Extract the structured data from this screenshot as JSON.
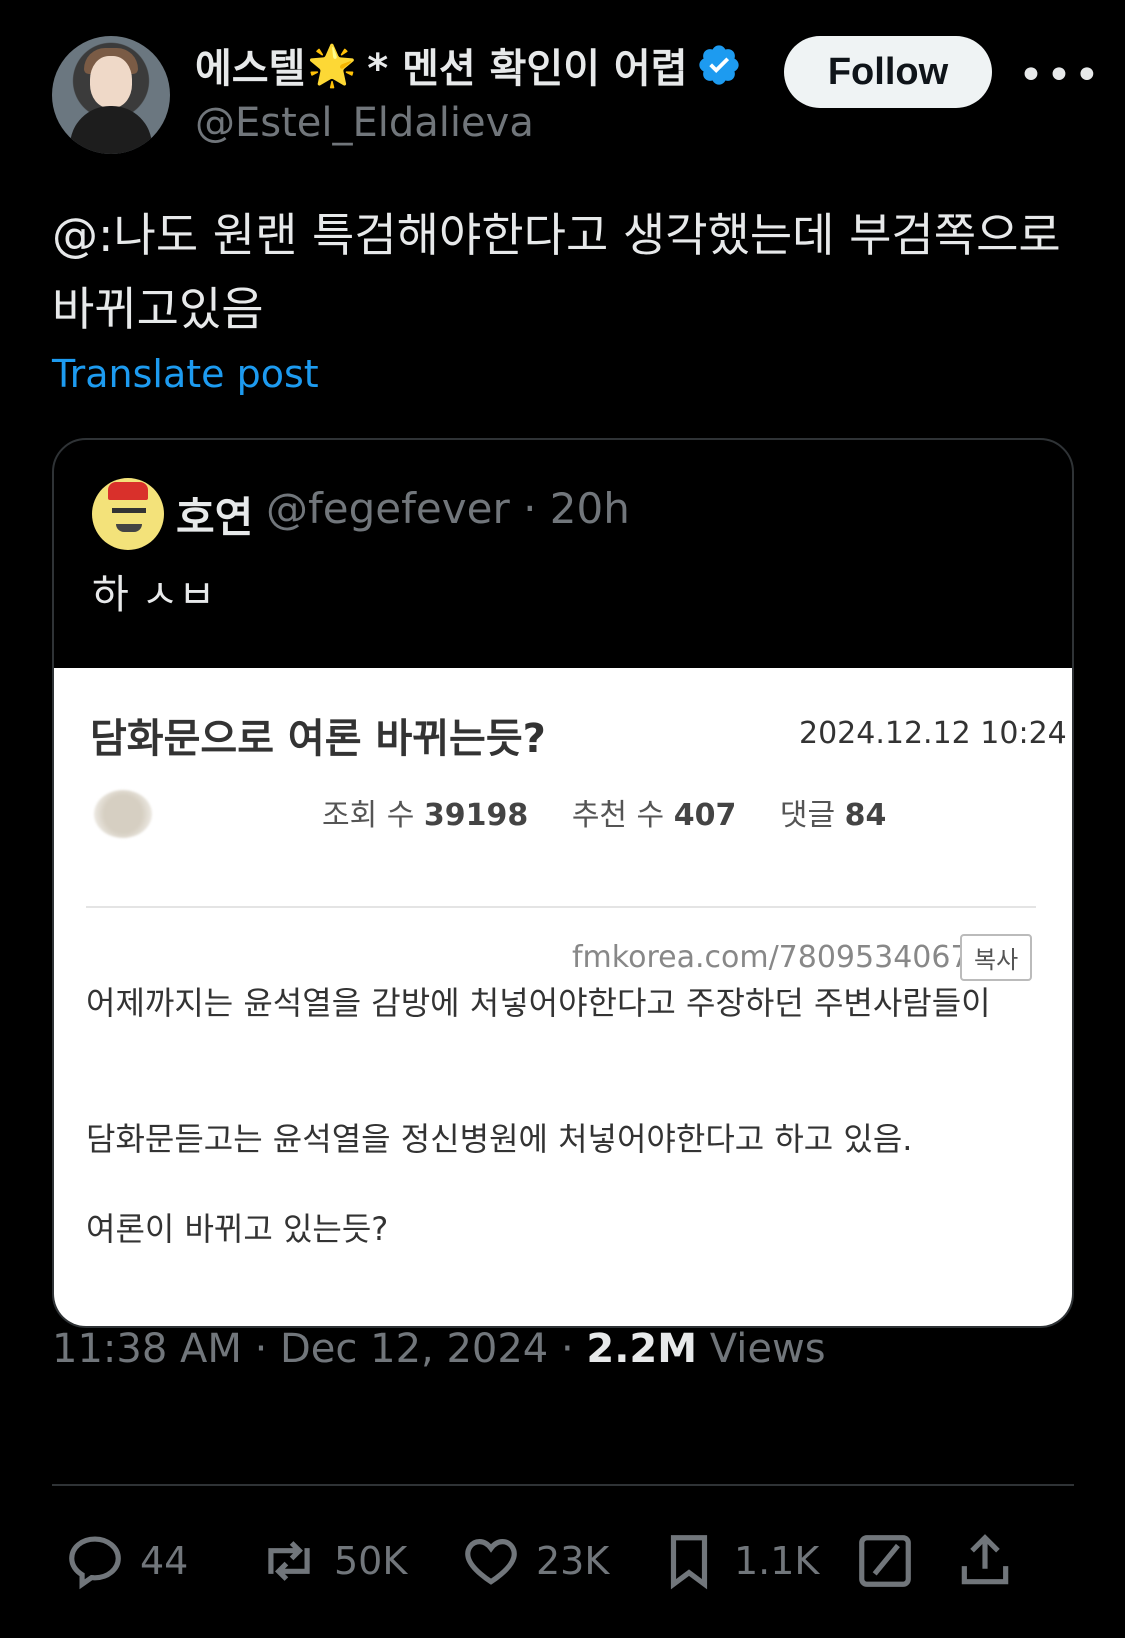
{
  "author": {
    "name": "에스텔",
    "emoji": "🌟",
    "name_suffix": "* 멘션 확인이 어렵",
    "handle": "@Estel_Eldalieva",
    "follow_label": "Follow",
    "more_label": "•••"
  },
  "post": {
    "text": "@:나도 원랜 특검해야한다고 생각했는데 부검쪽으로 바뀌고있음",
    "translate_label": "Translate post"
  },
  "quote": {
    "name": "호연",
    "meta": "@fegefever · 20h",
    "text": "하 ㅅㅂ",
    "screenshot": {
      "title": "담화문으로 여론 바뀌는듯?",
      "date": "2024.12.12 10:24",
      "views_label": "조회 수",
      "views": "39198",
      "recs_label": "추천 수",
      "recs": "407",
      "comments_label": "댓글",
      "comments": "84",
      "url": "fmkorea.com/7809534067",
      "copy_label": "복사",
      "body1": "어제까지는 윤석열을 감방에 처넣어야한다고 주장하던 주변사람들이",
      "body2": "담화문듣고는 윤석열을 정신병원에 처넣어야한다고 하고 있음.",
      "body3": "여론이 바뀌고 있는듯?"
    }
  },
  "timestamp": {
    "time": "11:38 AM · Dec 12, 2024 · ",
    "views_count": "2.2M",
    "views_label": " Views"
  },
  "actions": {
    "replies": "44",
    "reposts": "50K",
    "likes": "23K",
    "bookmarks": "1.1K"
  },
  "colors": {
    "background": "#000000",
    "link": "#1d9bf0",
    "verified": "#1d9bf0",
    "muted": "#71767b"
  }
}
